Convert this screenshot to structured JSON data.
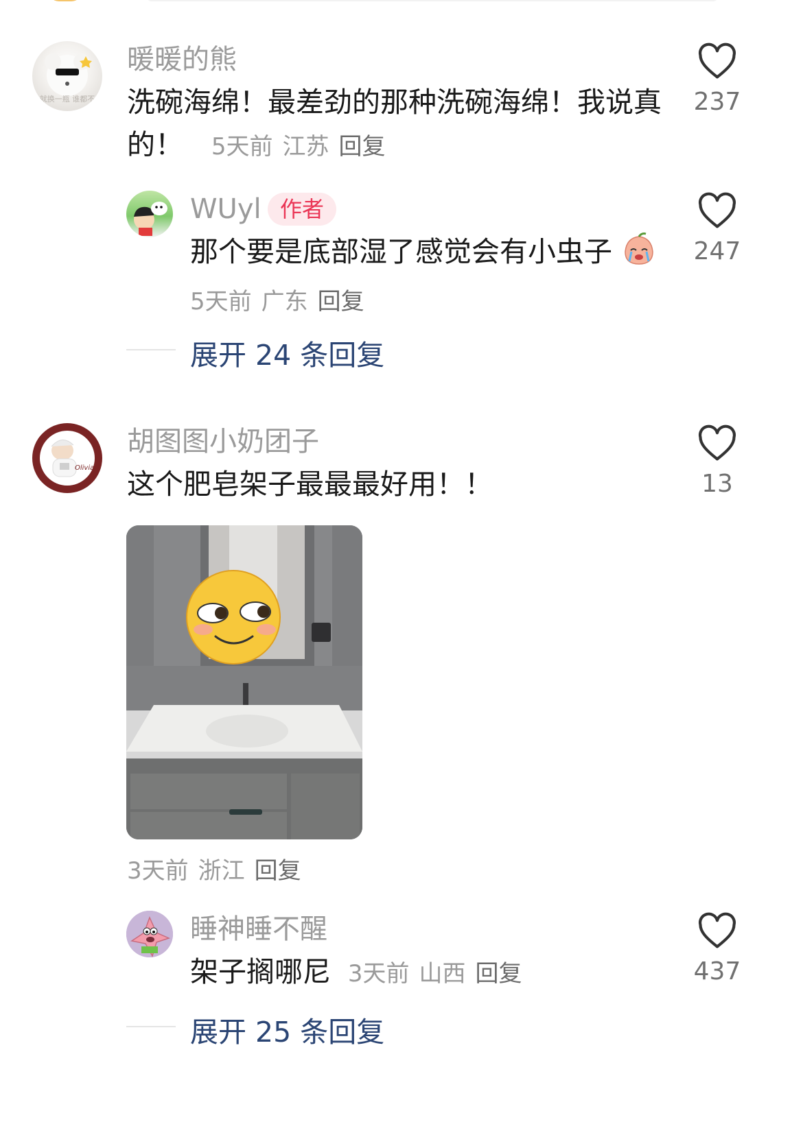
{
  "comments": [
    {
      "username": "暖暖的熊",
      "text": "洗碗海绵！最差劲的那种洗碗海绵！我说真的！",
      "time": "5天前",
      "location": "江苏",
      "reply_label": "回复",
      "likes": "237",
      "avatar_caption": "就换一瓶 谁都不",
      "replies": [
        {
          "username": "WUyl",
          "badge": "作者",
          "text": "那个要是底部湿了感觉会有小虫子",
          "time": "5天前",
          "location": "广东",
          "reply_label": "回复",
          "likes": "247"
        }
      ],
      "expand_label": "展开 24 条回复"
    },
    {
      "username": "胡图图小奶团子",
      "text": "这个肥皂架子最最最好用！！",
      "time": "3天前",
      "location": "浙江",
      "reply_label": "回复",
      "likes": "13",
      "avatar_caption": "Olivia",
      "replies": [
        {
          "username": "睡神睡不醒",
          "text": "架子搁哪尼",
          "time": "3天前",
          "location": "山西",
          "reply_label": "回复",
          "likes": "437"
        }
      ],
      "expand_label": "展开 25 条回复"
    }
  ],
  "colors": {
    "expand": "#2b4574",
    "badge_bg": "#fde9ec",
    "badge_text": "#ea3555",
    "muted": "#9a9a9a"
  }
}
